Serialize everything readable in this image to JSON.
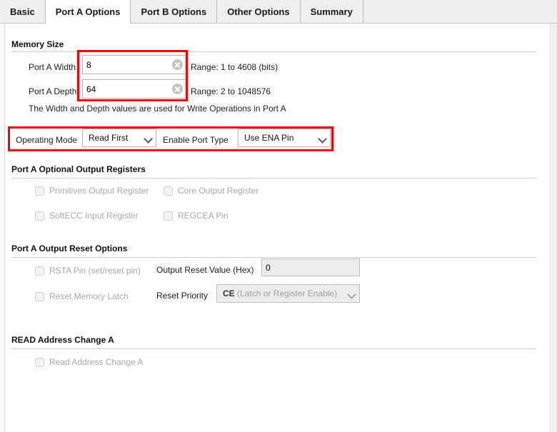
{
  "window": {
    "title": "Port A Options"
  },
  "tabs": [
    {
      "id": "basic",
      "label": "Basic",
      "active": false
    },
    {
      "id": "port-a",
      "label": "Port A Options",
      "active": true
    },
    {
      "id": "port-b",
      "label": "Port B Options",
      "active": false
    },
    {
      "id": "other",
      "label": "Other Options",
      "active": false
    },
    {
      "id": "summary",
      "label": "Summary",
      "active": false
    }
  ],
  "sections": {
    "memory_size": {
      "heading": "Memory Size",
      "port_a_width": {
        "label": "Port A Width",
        "value": "8",
        "range_text": "Range: 1 to 4608 (bits)",
        "clear_icon": "clear-circle-icon"
      },
      "port_a_depth": {
        "label": "Port A Depth",
        "value": "64",
        "range_text": "Range: 2 to 1048576",
        "clear_icon": "clear-circle-icon"
      },
      "note": "The Width and Depth values are used for Write Operations in Port A"
    },
    "mode_row": {
      "operating_mode": {
        "label": "Operating Mode",
        "value": "Read First",
        "caret_icon": "chevron-down-icon"
      },
      "enable_port_type": {
        "label": "Enable Port Type",
        "value": "Use ENA Pin",
        "caret_icon": "chevron-down-icon"
      }
    },
    "optional_output_registers": {
      "heading": "Port A Optional Output Registers",
      "checkboxes": [
        {
          "id": "primitives-output-register",
          "label": "Primitives Output Register",
          "checked": false,
          "enabled": false
        },
        {
          "id": "core-output-register",
          "label": "Core Output Register",
          "checked": false,
          "enabled": false
        },
        {
          "id": "softecc-input-register",
          "label": "SoftECC Input Register",
          "checked": false,
          "enabled": false
        },
        {
          "id": "regcea-pin",
          "label": "REGCEA Pin",
          "checked": false,
          "enabled": false
        }
      ]
    },
    "output_reset_options": {
      "heading": "Port A Output Reset Options",
      "checkboxes": [
        {
          "id": "rsta-pin",
          "label": "RSTA Pin (set/reset pin)",
          "checked": false,
          "enabled": false
        },
        {
          "id": "reset-memory-latch",
          "label": "Reset Memory Latch",
          "checked": false,
          "enabled": false
        }
      ],
      "output_reset_value": {
        "label": "Output Reset Value (Hex)",
        "value": "0"
      },
      "reset_priority": {
        "label": "Reset Priority",
        "value_strong": "CE",
        "value_weak": "(Latch or Register Enable)",
        "caret_icon": "chevron-down-icon"
      }
    },
    "read_address_change": {
      "heading": "READ Address Change A",
      "checkbox": {
        "id": "read-address-change-a",
        "label": "Read Address Change A",
        "checked": false,
        "enabled": false
      }
    }
  },
  "annotations": [
    {
      "id": "memory-size-fields-highlight",
      "color": "#ff0000"
    },
    {
      "id": "operating-mode-row-highlight",
      "color": "#ff0000"
    }
  ]
}
